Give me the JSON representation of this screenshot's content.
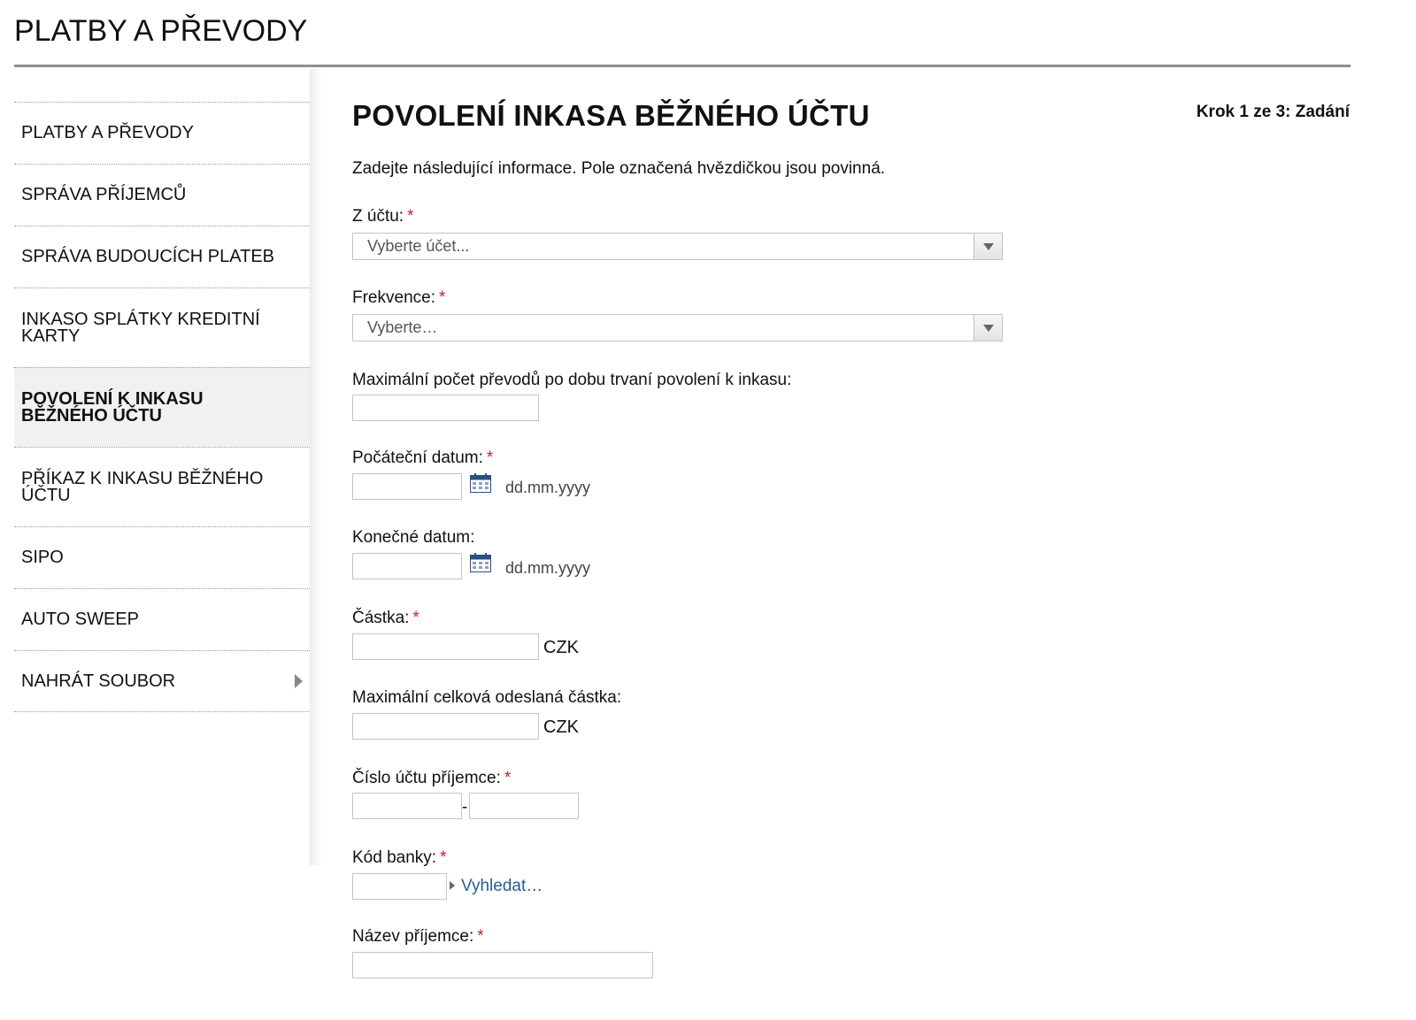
{
  "header": {
    "title": "PLATBY A PŘEVODY"
  },
  "sidebar": {
    "items": [
      {
        "label": "PLATBY A PŘEVODY"
      },
      {
        "label": "SPRÁVA PŘÍJEMCŮ"
      },
      {
        "label": "SPRÁVA BUDOUCÍCH PLATEB"
      },
      {
        "label": "INKASO SPLÁTKY KREDITNÍ KARTY"
      },
      {
        "label": "POVOLENÍ K INKASU BĚŽNÉHO ÚČTU",
        "active": true
      },
      {
        "label": "PŘÍKAZ K INKASU BĚŽNÉHO ÚČTU"
      },
      {
        "label": "SIPO"
      },
      {
        "label": "AUTO SWEEP"
      },
      {
        "label": "NAHRÁT SOUBOR",
        "has_submenu": true
      }
    ]
  },
  "main": {
    "heading": "POVOLENÍ INKASA BĚŽNÉHO ÚČTU",
    "step": "Krok 1 ze 3: Zadání",
    "intro": "Zadejte následující informace. Pole označená hvězdičkou jsou povinná.",
    "required_mark": "*",
    "fields": {
      "from_account": {
        "label": "Z účtu:",
        "value": "Vyberte účet..."
      },
      "frequency": {
        "label": "Frekvence:",
        "value": "Vyberte…"
      },
      "max_transfers": {
        "label": "Maximální počet převodů po dobu trvaní povolení k inkasu:",
        "value": ""
      },
      "start_date": {
        "label": "Počáteční datum:",
        "value": "",
        "format_hint": "dd.mm.yyyy"
      },
      "end_date": {
        "label": "Konečné datum:",
        "value": "",
        "format_hint": "dd.mm.yyyy"
      },
      "amount": {
        "label": "Částka:",
        "value": "",
        "currency": "CZK"
      },
      "max_total": {
        "label": "Maximální celková odeslaná částka:",
        "value": "",
        "currency": "CZK"
      },
      "recipient_account": {
        "label": "Číslo účtu příjemce:",
        "prefix": "",
        "number": "",
        "separator": "-"
      },
      "bank_code": {
        "label": "Kód banky:",
        "value": "",
        "lookup_label": "Vyhledat…"
      },
      "recipient_name": {
        "label": "Název příjemce:",
        "value": ""
      }
    }
  },
  "colors": {
    "required": "#cc1f1f",
    "link": "#2b5a99",
    "rule": "#8a8f94",
    "active_bg": "#f1f1f1",
    "calendar_icon": "#2a4f7e"
  },
  "icons": {
    "calendar": "calendar-icon",
    "select_arrow": "chevron-down-icon",
    "submenu_arrow": "chevron-right-icon",
    "lookup_arrow": "triangle-right-icon"
  }
}
